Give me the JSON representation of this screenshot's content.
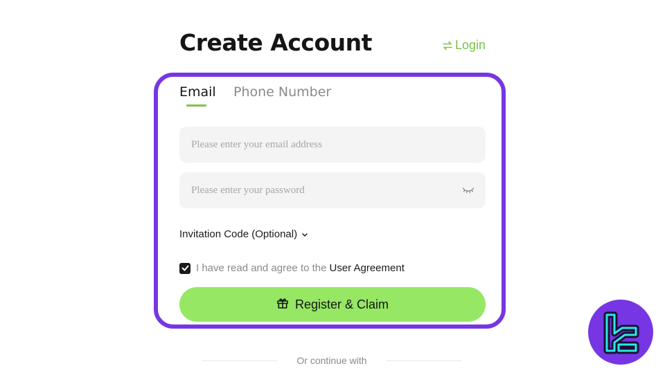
{
  "header": {
    "title": "Create Account",
    "login_label": "Login"
  },
  "tabs": [
    {
      "label": "Email",
      "active": true
    },
    {
      "label": "Phone Number",
      "active": false
    }
  ],
  "form": {
    "email_placeholder": "Please enter your email address",
    "email_value": "",
    "password_placeholder": "Please enter your password",
    "password_value": "",
    "invitation_label": "Invitation Code (Optional)",
    "agree_text": "I have read and agree to the",
    "agree_link": "User Agreement",
    "agree_checked": true,
    "register_label": "Register & Claim"
  },
  "footer": {
    "continue_text": "Or continue with"
  },
  "icons": {
    "login": "swap-arrows-icon",
    "password_toggle": "eye-closed-icon",
    "invitation_toggle": "chevron-down-icon",
    "checkbox": "checkmark-icon",
    "register": "gift-icon",
    "brand": "brand-logo-icon"
  },
  "colors": {
    "accent_green": "#7cc24a",
    "button_green": "#95e764",
    "highlight_purple": "#7636e3",
    "logo_cyan": "#2ee6e6"
  }
}
